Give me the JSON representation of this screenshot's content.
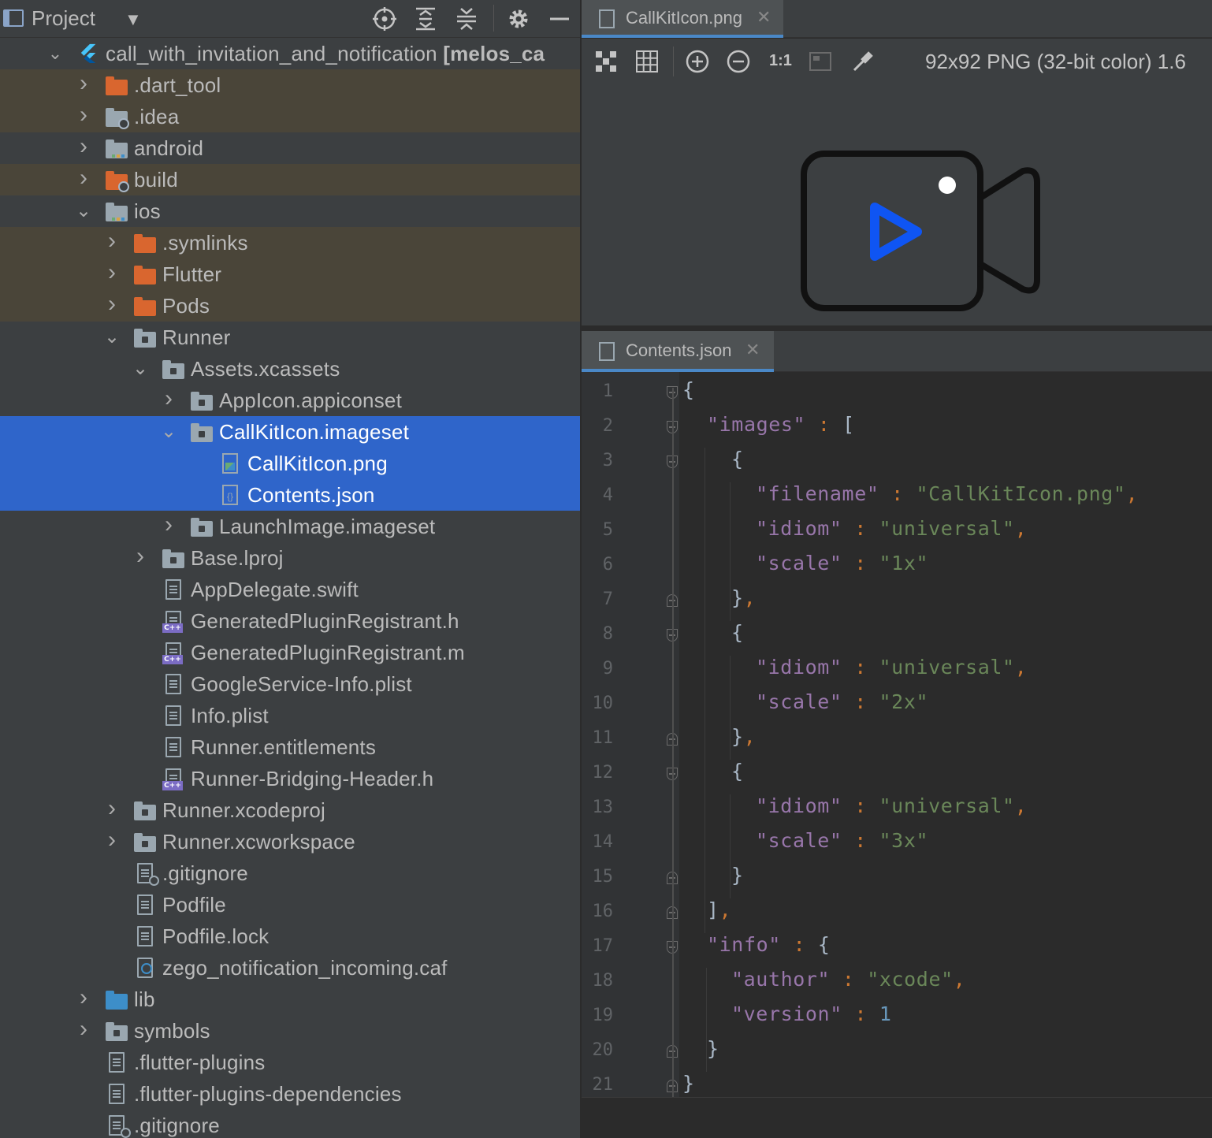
{
  "project_panel": {
    "title": "Project",
    "root_label": "call_with_invitation_and_notification",
    "root_module": "[melos_ca"
  },
  "tree": [
    {
      "label": ".dart_tool",
      "icon": "folder-orange"
    },
    {
      "label": ".idea",
      "icon": "folder-settings"
    },
    {
      "label": "android",
      "icon": "folder-module"
    },
    {
      "label": "build",
      "icon": "folder-settings-orange"
    },
    {
      "label": "ios",
      "icon": "folder-module"
    },
    {
      "label": ".symlinks",
      "icon": "folder-orange"
    },
    {
      "label": "Flutter",
      "icon": "folder-orange"
    },
    {
      "label": "Pods",
      "icon": "folder-orange"
    },
    {
      "label": "Runner",
      "icon": "folder-gray"
    },
    {
      "label": "Assets.xcassets",
      "icon": "folder-gray"
    },
    {
      "label": "AppIcon.appiconset",
      "icon": "folder-gray"
    },
    {
      "label": "CallKitIcon.imageset",
      "icon": "folder-gray"
    },
    {
      "label": "CallKitIcon.png",
      "icon": "image-file"
    },
    {
      "label": "Contents.json",
      "icon": "json-file"
    },
    {
      "label": "LaunchImage.imageset",
      "icon": "folder-gray"
    },
    {
      "label": "Base.lproj",
      "icon": "folder-gray"
    },
    {
      "label": "AppDelegate.swift",
      "icon": "text-file"
    },
    {
      "label": "GeneratedPluginRegistrant.h",
      "icon": "cpp-file"
    },
    {
      "label": "GeneratedPluginRegistrant.m",
      "icon": "cpp-file"
    },
    {
      "label": "GoogleService-Info.plist",
      "icon": "text-file"
    },
    {
      "label": "Info.plist",
      "icon": "text-file"
    },
    {
      "label": "Runner.entitlements",
      "icon": "text-file"
    },
    {
      "label": "Runner-Bridging-Header.h",
      "icon": "cpp-file"
    },
    {
      "label": "Runner.xcodeproj",
      "icon": "folder-gray"
    },
    {
      "label": "Runner.xcworkspace",
      "icon": "folder-gray"
    },
    {
      "label": ".gitignore",
      "icon": "ignore-file"
    },
    {
      "label": "Podfile",
      "icon": "text-file"
    },
    {
      "label": "Podfile.lock",
      "icon": "text-file"
    },
    {
      "label": "zego_notification_incoming.caf",
      "icon": "audio-file"
    },
    {
      "label": "lib",
      "icon": "folder-blue"
    },
    {
      "label": "symbols",
      "icon": "folder-gray"
    },
    {
      "label": ".flutter-plugins",
      "icon": "text-file"
    },
    {
      "label": ".flutter-plugins-dependencies",
      "icon": "text-file"
    },
    {
      "label": ".gitignore",
      "icon": "ignore-file"
    }
  ],
  "image_tab": {
    "label": "CallKitIcon.png"
  },
  "image_toolbar": {
    "zoom_actual_label": "1:1",
    "info": "92x92 PNG (32-bit color) 1.6"
  },
  "json_tab": {
    "label": "Contents.json"
  },
  "editor": {
    "line_numbers": [
      "1",
      "2",
      "3",
      "4",
      "5",
      "6",
      "7",
      "8",
      "9",
      "10",
      "11",
      "12",
      "13",
      "14",
      "15",
      "16",
      "17",
      "18",
      "19",
      "20",
      "21"
    ]
  },
  "colors": {
    "selection": "#2f65ca",
    "excluded_bg": "#4a4539",
    "json_key": "#9876aa",
    "json_string": "#6a8759",
    "json_number": "#6897bb",
    "icon_blue": "#0f55f3"
  }
}
